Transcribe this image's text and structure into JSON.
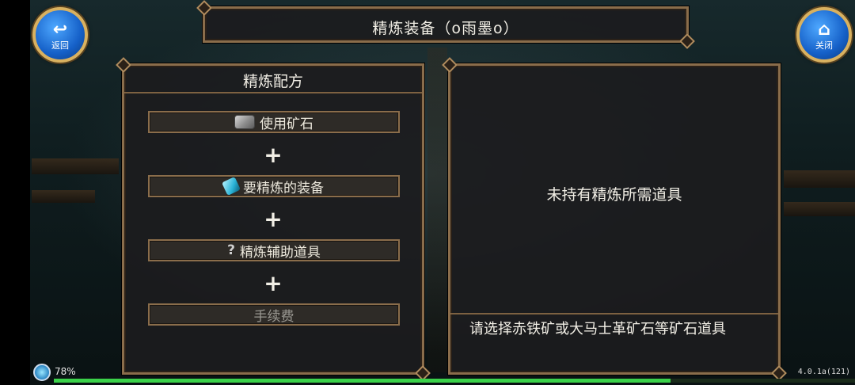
{
  "header": {
    "title": "精炼装备（o雨墨o）",
    "back_label": "返回",
    "close_label": "关闭"
  },
  "recipe": {
    "title": "精炼配方",
    "slots": [
      {
        "label": "使用矿石",
        "icon": "ore-icon"
      },
      {
        "label": "要精炼的装备",
        "icon": "equipment-icon"
      },
      {
        "label": "精炼辅助道具",
        "icon": "question-icon"
      },
      {
        "label": "手续费",
        "icon": ""
      }
    ],
    "plus": "+"
  },
  "result": {
    "message": "未持有精炼所需道具",
    "hint": "请选择赤铁矿或大马士革矿石等矿石道具"
  },
  "status": {
    "battery": "78%",
    "version": "4.0.1a(121)",
    "progress_fraction": 0.77
  },
  "colors": {
    "frame": "#8a6d4b",
    "button_blue": "#1560c8",
    "progress_green": "#3bd24a"
  }
}
